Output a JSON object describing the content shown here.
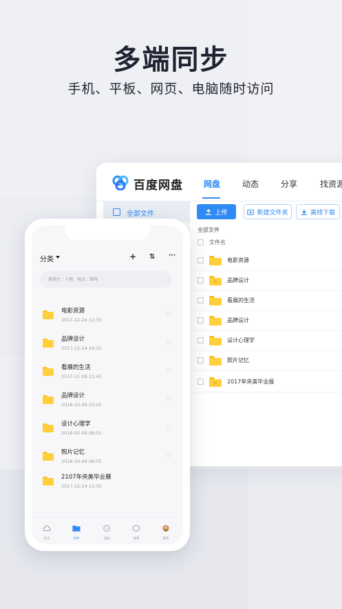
{
  "headline": "多端同步",
  "subline": "手机、平板、网页、电脑随时访问",
  "colors": {
    "accent": "#2f8bf3",
    "folder": "#ffcf3e"
  },
  "desktop": {
    "brand": "百度网盘",
    "nav": [
      "网盘",
      "动态",
      "分享",
      "找资源"
    ],
    "active_nav": "网盘",
    "sidebar_item": "全部文件",
    "upload_button": "上传",
    "new_folder_button": "新建文件夹",
    "offline_download_button": "离线下载",
    "breadcrumb": "全部文件",
    "column_header": "文件名",
    "files": [
      {
        "name": "电影资源",
        "icon": "folder-icon"
      },
      {
        "name": "品牌设计",
        "icon": "shared-folder-icon"
      },
      {
        "name": "看展的生活",
        "icon": "folder-icon"
      },
      {
        "name": "品牌设计",
        "icon": "folder-icon"
      },
      {
        "name": "设计心理学",
        "icon": "folder-icon"
      },
      {
        "name": "照片记忆",
        "icon": "folder-icon"
      },
      {
        "name": "2017年央美毕业展",
        "icon": "shared-folder-icon"
      }
    ]
  },
  "mobile": {
    "category": "分类",
    "actions": [
      "+",
      "⇅",
      "···"
    ],
    "search_placeholder": "搜照片：人物、地点、事物",
    "files": [
      {
        "name": "电影资源",
        "date": "2017-12-24 12:35"
      },
      {
        "name": "品牌设计",
        "date": "2017-12-24 14:32"
      },
      {
        "name": "看展的生活",
        "date": "2017-11-28 21:45"
      },
      {
        "name": "品牌设计",
        "date": "2018-10-09 10:25"
      },
      {
        "name": "设计心理学",
        "date": "2019-05-09 08:55"
      },
      {
        "name": "照片记忆",
        "date": "2018-10-09 08:55"
      },
      {
        "name": "2107年央美毕业展",
        "date": "2017-12-24 12:35"
      }
    ],
    "tabs": [
      {
        "label": "首页",
        "icon": "cloud-icon"
      },
      {
        "label": "文件",
        "icon": "folder-icon"
      },
      {
        "label": "消息",
        "icon": "message-icon"
      },
      {
        "label": "发现",
        "icon": "discover-icon"
      },
      {
        "label": "我的",
        "icon": "avatar-icon"
      }
    ],
    "active_tab": "文件"
  }
}
